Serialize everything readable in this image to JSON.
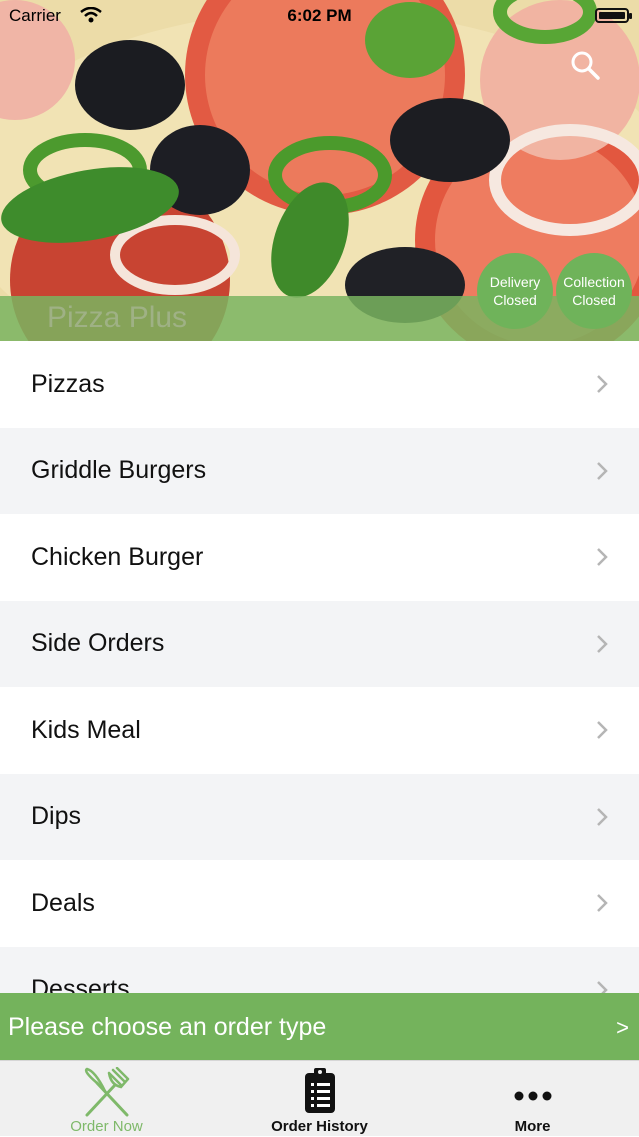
{
  "status_bar": {
    "carrier": "Carrier",
    "time": "6:02 PM"
  },
  "header": {
    "shop_name": "Pizza Plus",
    "search_icon": "search-icon",
    "delivery_badge": {
      "line1": "Delivery",
      "line2": "Closed"
    },
    "collection_badge": {
      "line1": "Collection",
      "line2": "Closed"
    }
  },
  "categories": [
    {
      "label": "Pizzas"
    },
    {
      "label": "Griddle Burgers"
    },
    {
      "label": "Chicken Burger"
    },
    {
      "label": "Side Orders"
    },
    {
      "label": "Kids Meal"
    },
    {
      "label": "Dips"
    },
    {
      "label": "Deals"
    },
    {
      "label": "Desserts"
    }
  ],
  "order_bar": {
    "text": "Please choose an order type",
    "arrow": ">"
  },
  "tab_bar": {
    "tabs": [
      {
        "label": "Order Now",
        "icon": "fork-knife-icon",
        "active": true
      },
      {
        "label": "Order History",
        "icon": "clipboard-icon",
        "active": false
      },
      {
        "label": "More",
        "icon": "more-dots-icon",
        "active": false
      }
    ]
  },
  "colors": {
    "accent_green": "#74b35c",
    "active_tab": "#7fb96a",
    "row_alt": "#f3f4f6"
  }
}
